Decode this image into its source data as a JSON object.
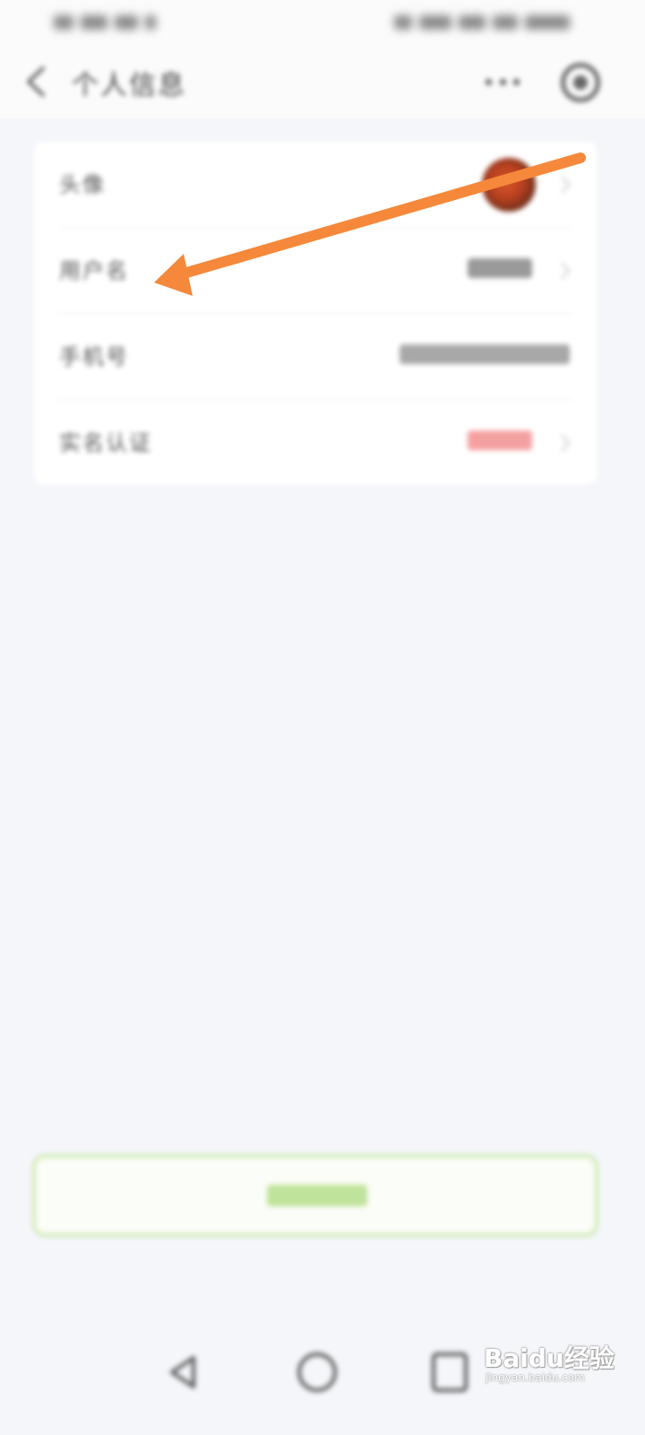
{
  "header": {
    "title": "个人信息"
  },
  "profile": {
    "rows": [
      {
        "label": "头像"
      },
      {
        "label": "用户名"
      },
      {
        "label": "手机号"
      },
      {
        "label": "实名认证"
      }
    ]
  },
  "colors": {
    "annotation_arrow": "#f5883a",
    "logout_border": "#cfe9b3",
    "verify_status": "#f04a4a"
  },
  "watermark": {
    "main": "Baidu经验",
    "sub": "jingyan.baidu.com"
  }
}
